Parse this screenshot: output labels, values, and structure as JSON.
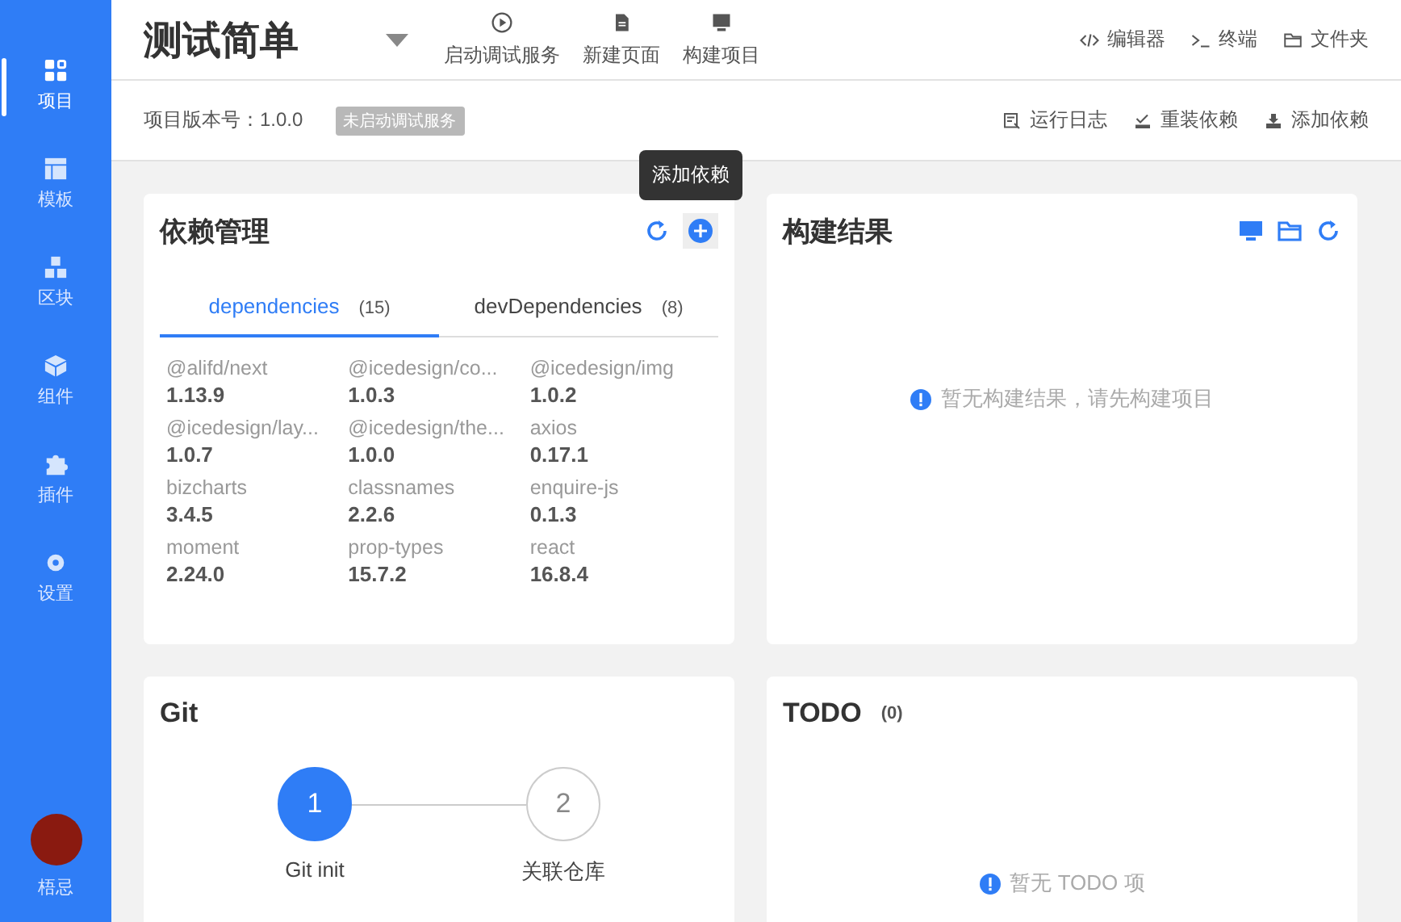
{
  "sidebar": {
    "items": [
      {
        "label": "项目",
        "selected": true
      },
      {
        "label": "模板",
        "selected": false
      },
      {
        "label": "区块",
        "selected": false
      },
      {
        "label": "组件",
        "selected": false
      },
      {
        "label": "插件",
        "selected": false
      },
      {
        "label": "设置",
        "selected": false
      }
    ],
    "user": {
      "name": "梧忌"
    }
  },
  "header": {
    "title": "测试简单",
    "actions": [
      "启动调试服务",
      "新建页面",
      "构建项目"
    ],
    "tools": [
      "编辑器",
      "终端",
      "文件夹"
    ]
  },
  "subheader": {
    "version_label": "项目版本号：1.0.0",
    "status_badge": "未启动调试服务",
    "actions": [
      "运行日志",
      "重装依赖",
      "添加依赖"
    ]
  },
  "tooltip": "添加依赖",
  "dependencies": {
    "title": "依赖管理",
    "tabs": [
      {
        "label": "dependencies",
        "count": "(15)",
        "selected": true
      },
      {
        "label": "devDependencies",
        "count": "(8)",
        "selected": false
      }
    ],
    "items": [
      {
        "name": "@alifd/next",
        "version": "1.13.9"
      },
      {
        "name": "@icedesign/co...",
        "version": "1.0.3"
      },
      {
        "name": "@icedesign/img",
        "version": "1.0.2"
      },
      {
        "name": "@icedesign/lay...",
        "version": "1.0.7"
      },
      {
        "name": "@icedesign/the...",
        "version": "1.0.0"
      },
      {
        "name": "axios",
        "version": "0.17.1"
      },
      {
        "name": "bizcharts",
        "version": "3.4.5"
      },
      {
        "name": "classnames",
        "version": "2.2.6"
      },
      {
        "name": "enquire-js",
        "version": "0.1.3"
      },
      {
        "name": "moment",
        "version": "2.24.0"
      },
      {
        "name": "prop-types",
        "version": "15.7.2"
      },
      {
        "name": "react",
        "version": "16.8.4"
      }
    ]
  },
  "build": {
    "title": "构建结果",
    "empty": "暂无构建结果，请先构建项目"
  },
  "git": {
    "title": "Git",
    "steps": [
      {
        "number": "1",
        "label": "Git init",
        "selected": true
      },
      {
        "number": "2",
        "label": "关联仓库",
        "selected": false
      }
    ]
  },
  "todo": {
    "title": "TODO",
    "count": "(0)",
    "empty": "暂无 TODO 项"
  }
}
